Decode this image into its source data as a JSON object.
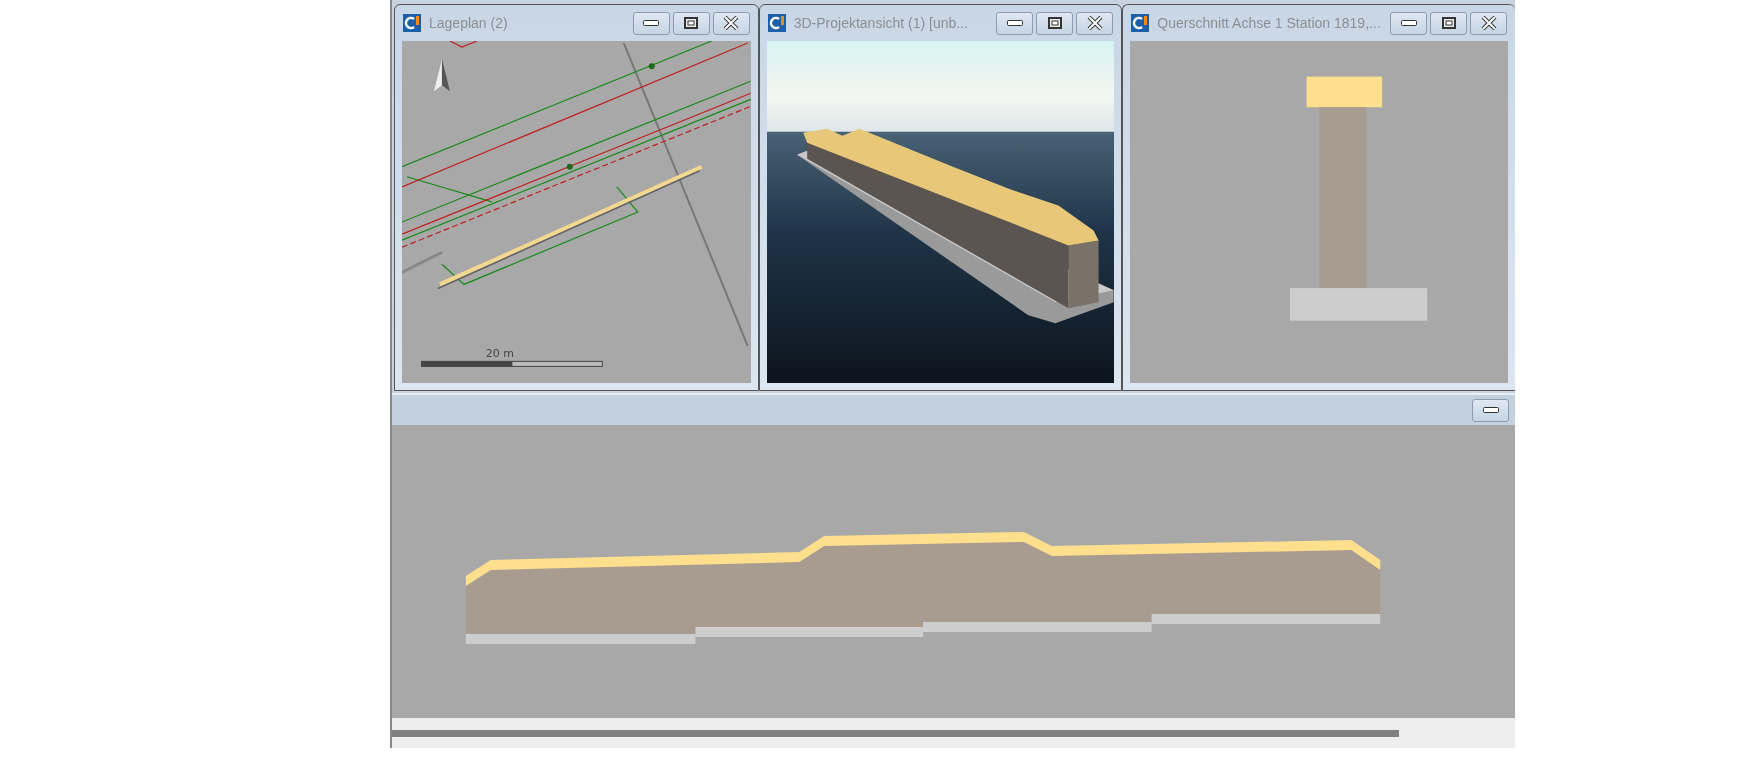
{
  "windows": [
    {
      "title": "Lageplan (2)",
      "kind": "plan",
      "scale_label": "20 m",
      "buttons": [
        {
          "kind": "minimize"
        },
        {
          "kind": "maximize"
        },
        {
          "kind": "close"
        }
      ]
    },
    {
      "title": "3D-Projektansicht (1) [unb...",
      "kind": "perspective",
      "buttons": [
        {
          "kind": "minimize"
        },
        {
          "kind": "maximize"
        },
        {
          "kind": "close"
        }
      ]
    },
    {
      "title": "Querschnitt Achse 1 Station 1819,...",
      "kind": "section",
      "buttons": [
        {
          "kind": "minimize"
        },
        {
          "kind": "maximize"
        },
        {
          "kind": "close"
        }
      ]
    }
  ],
  "profile_panel": {
    "kind": "profile",
    "buttons": [
      {
        "kind": "minimize"
      }
    ]
  }
}
